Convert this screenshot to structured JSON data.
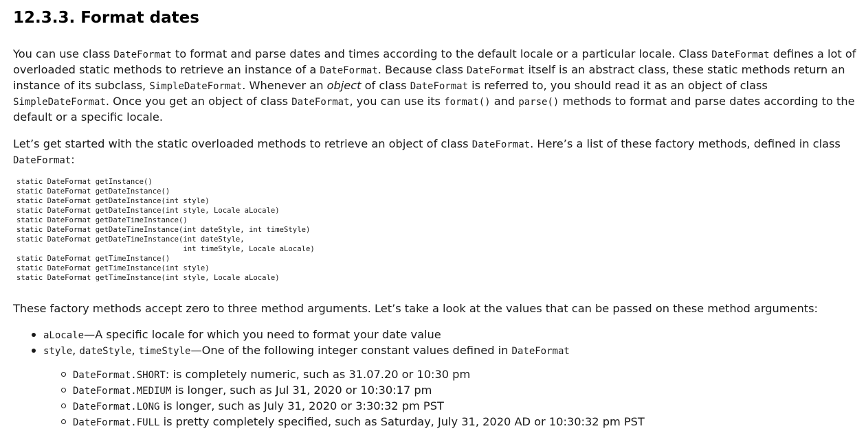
{
  "heading": "12.3.3. Format dates",
  "p1": [
    "You can use class ",
    "DateFormat",
    " to format and parse dates and times according to the default locale or a particular locale. Class ",
    "DateFormat",
    " defines a lot of overloaded static methods to retrieve an instance of a ",
    "DateFormat",
    ". Because class ",
    "DateFormat",
    " itself is an abstract class, these static methods return an instance of its subclass, ",
    "SimpleDateFormat",
    ". Whenever an ",
    "object",
    " of class ",
    "DateFormat",
    " is referred to, you should read it as an object of class ",
    "SimpleDateFormat",
    ". Once you get an object of class ",
    "DateFormat",
    ", you can use its ",
    "format()",
    " and ",
    "parse()",
    " methods to format and parse dates according to the default or a specific locale."
  ],
  "p2": [
    "Let’s get started with the static overloaded methods to retrieve an object of class ",
    "DateFormat",
    ". Here’s a list of these factory methods, defined in class ",
    "DateFormat",
    ":"
  ],
  "code_lines": [
    "static DateFormat getInstance()",
    "static DateFormat getDateInstance()",
    "static DateFormat getDateInstance(int style)",
    "static DateFormat getDateInstance(int style, Locale aLocale)",
    "static DateFormat getDateTimeInstance()",
    "static DateFormat getDateTimeInstance(int dateStyle, int timeStyle)",
    "static DateFormat getDateTimeInstance(int dateStyle,",
    "                                      int timeStyle, Locale aLocale)",
    "static DateFormat getTimeInstance()",
    "static DateFormat getTimeInstance(int style)",
    "static DateFormat getTimeInstance(int style, Locale aLocale)"
  ],
  "p3": "These factory methods accept zero to three method arguments. Let’s take a look at the values that can be passed on these method arguments:",
  "bullets": [
    {
      "code": "aLocale",
      "text": "—A specific locale for which you need to format your date value"
    },
    {
      "parts": [
        "style",
        ", ",
        "dateStyle",
        ", ",
        "timeStyle",
        "—One of the following integer constant values defined in ",
        "DateFormat"
      ]
    }
  ],
  "sub_bullets": [
    {
      "code": "DateFormat.SHORT",
      "text": ": is completely numeric, such as 31.07.20 or 10:30 pm"
    },
    {
      "code": "DateFormat.MEDIUM",
      "text": " is longer, such as Jul 31, 2020 or 10:30:17 pm"
    },
    {
      "code": "DateFormat.LONG",
      "text": " is longer, such as July 31, 2020 or 3:30:32 pm PST"
    },
    {
      "code": "DateFormat.FULL",
      "text": " is pretty completely specified, such as Saturday, July 31, 2020 AD or 10:30:32 pm PST"
    }
  ]
}
